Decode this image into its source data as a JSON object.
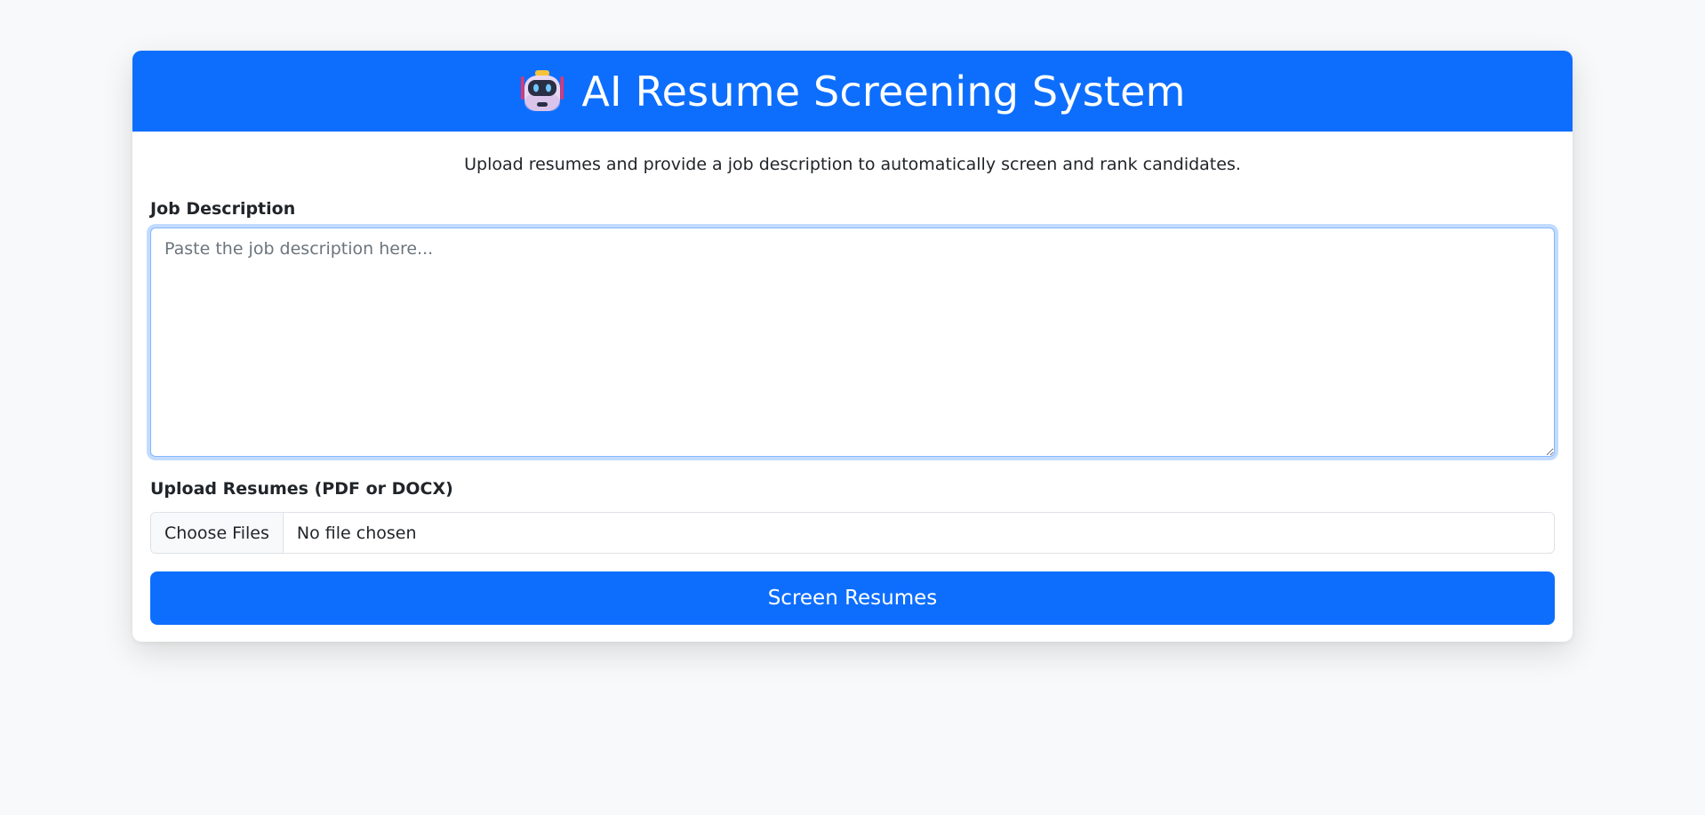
{
  "header": {
    "icon": "robot-face-icon",
    "title": "AI Resume Screening System"
  },
  "intro": {
    "text": "Upload resumes and provide a job description to automatically screen and rank candidates."
  },
  "job_description": {
    "label": "Job Description",
    "value": "",
    "placeholder": "Paste the job description here..."
  },
  "upload": {
    "label": "Upload Resumes (PDF or DOCX)",
    "button_label": "Choose Files",
    "status": "No file chosen"
  },
  "actions": {
    "submit_label": "Screen Resumes"
  },
  "colors": {
    "accent": "#0d6efd",
    "page_background": "#f8f9fa",
    "card_background": "#ffffff"
  }
}
